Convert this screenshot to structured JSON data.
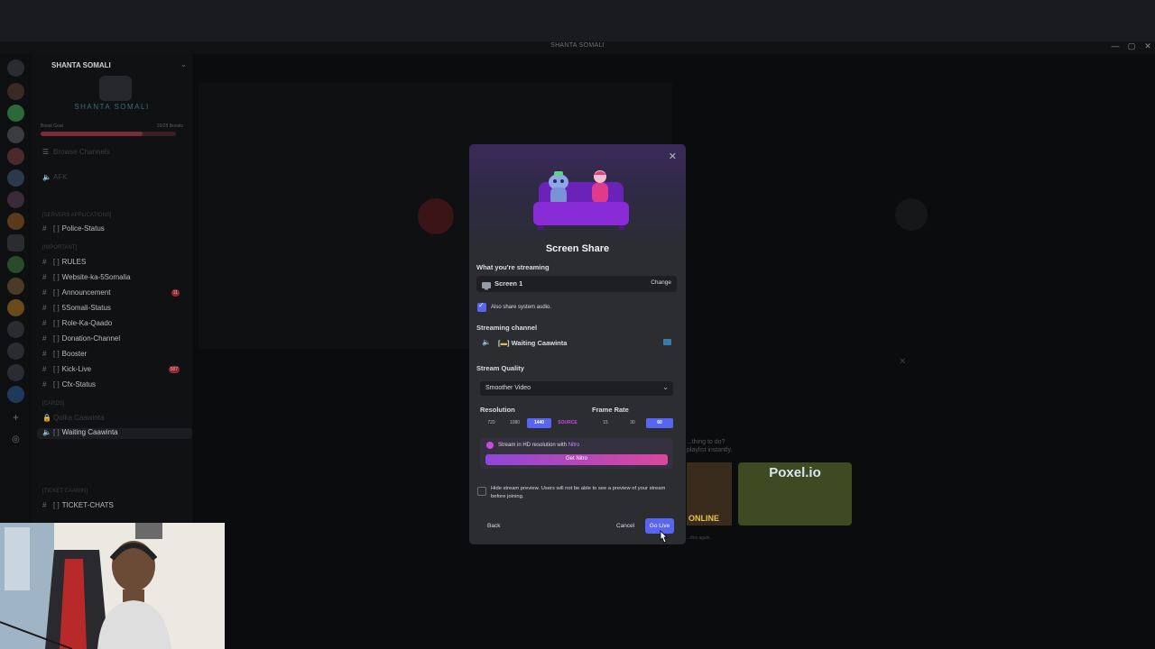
{
  "window": {
    "title": "SHANTA SOMALI",
    "controls": [
      "—",
      "▢",
      "✕"
    ]
  },
  "sidebar": {
    "server_name": "SHANTA SOMALI",
    "banner_text": "SHANTA SOMALI",
    "boost_label": "Boost Goal",
    "boost_count": "20/28 Boosts",
    "browse": "Browse Channels",
    "channels": [
      {
        "name": "AFK",
        "type": "voice",
        "dim": true
      },
      {
        "name": "[SERVERS APPLICATIONS]",
        "type": "category",
        "dim": true
      },
      {
        "name": "Police-Status",
        "prefix": "[ ]"
      },
      {
        "name": "[IMPORTANT]",
        "type": "category",
        "dim": true
      },
      {
        "name": "RULES",
        "prefix": "[ ]"
      },
      {
        "name": "Website-ka-5Somalia",
        "prefix": "[ ]"
      },
      {
        "name": "Announcement",
        "prefix": "[ ]",
        "badge": "11"
      },
      {
        "name": "5Somali-Status",
        "prefix": "[ ]"
      },
      {
        "name": "Role-Ka-Qaado",
        "prefix": "[ ]"
      },
      {
        "name": "Donation-Channel",
        "prefix": "[ ]"
      },
      {
        "name": "Booster",
        "prefix": "[ ]"
      },
      {
        "name": "Kick-Live",
        "prefix": "[ ]",
        "badge": "587"
      },
      {
        "name": "Cfx-Status",
        "prefix": "[ ]"
      },
      {
        "name": "[CARDS]",
        "type": "category",
        "dim": true
      },
      {
        "name": "Qolka Caawinta",
        "type": "voice",
        "dim": true
      },
      {
        "name": "Waiting Caawinta",
        "type": "voice",
        "selected": true
      },
      {
        "name": "[TICKET CAAWIN]",
        "type": "category",
        "dim": true
      },
      {
        "name": "TICKET-CHATS",
        "prefix": "[ ]"
      }
    ]
  },
  "background": {
    "activity_prompt": "...thing to do?",
    "activity_sub": "playlist instantly.",
    "game1": "ONLINE",
    "game2": "Poxel.io",
    "footer": "...this again."
  },
  "modal": {
    "title": "Screen Share",
    "streaming_label": "What you're streaming",
    "source": "Screen 1",
    "change_label": "Change",
    "audio_checkbox": {
      "label": "Also share system audio.",
      "checked": true
    },
    "channel_label": "Streaming channel",
    "channel_name": "Waiting Caawinta",
    "quality_label": "Stream Quality",
    "quality_value": "Smoother Video",
    "resolution_label": "Resolution",
    "resolutions": [
      "720",
      "1080",
      "1440",
      "SOURCE"
    ],
    "resolution_selected": "1440",
    "framerate_label": "Frame Rate",
    "framerates": [
      "15",
      "30",
      "60"
    ],
    "framerate_selected": "60",
    "nitro_line_prefix": "Stream in HD resolution with",
    "nitro_line_highlight": "Nitro",
    "get_nitro": "Get Nitro",
    "hide_preview": {
      "label": "Hide stream preview. Users will not be able to see a preview of your stream before joining.",
      "checked": false
    },
    "back": "Back",
    "cancel": "Cancel",
    "go_live": "Go Live"
  },
  "colors": {
    "accent": "#5865f2",
    "nitro_pink": "#d9489b",
    "modal_bg": "#2b2d31"
  }
}
